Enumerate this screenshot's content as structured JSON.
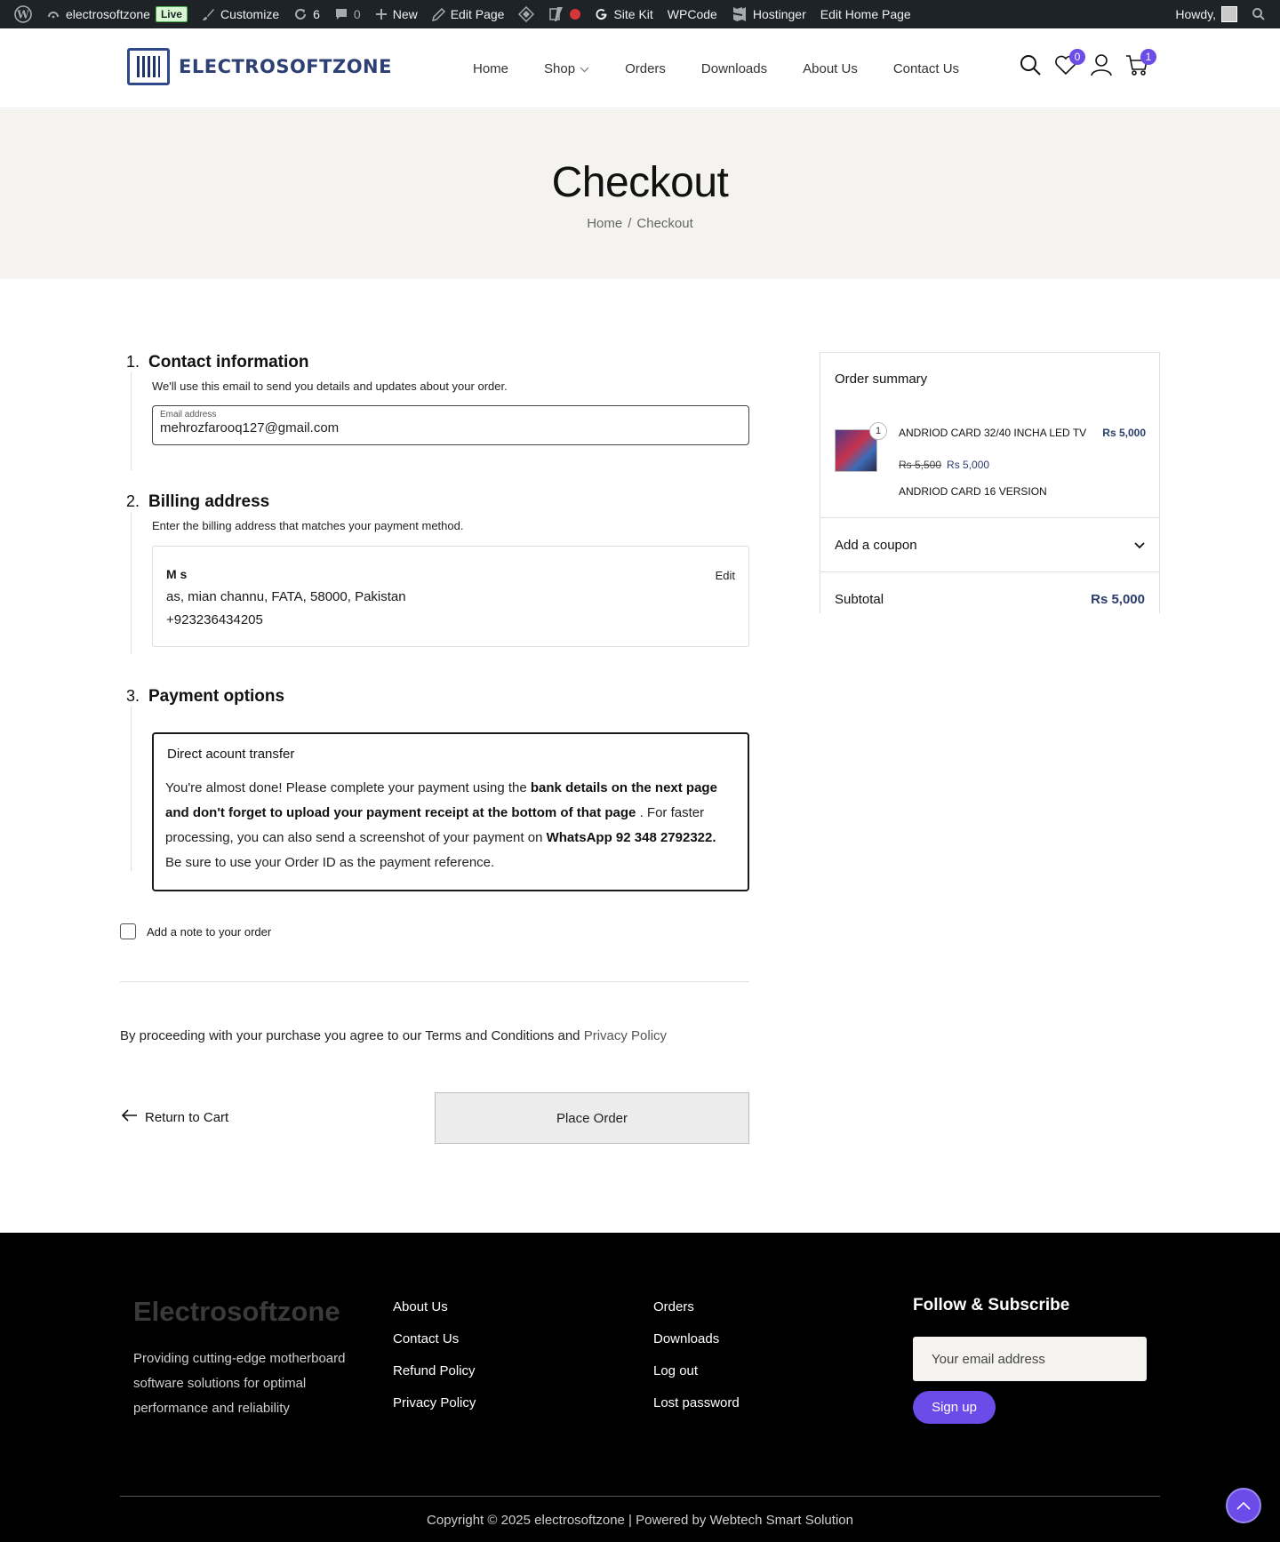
{
  "adminbar": {
    "site_name": "electrosoftzone",
    "live_badge": "Live",
    "customize": "Customize",
    "updates_count": "6",
    "comments_count": "0",
    "new": "New",
    "edit_page": "Edit Page",
    "site_kit": "Site Kit",
    "wpcode": "WPCode",
    "hostinger": "Hostinger",
    "edit_home_page": "Edit Home Page",
    "howdy": "Howdy,"
  },
  "header": {
    "logo_text": "ELECTROSOFTZONE",
    "nav": [
      "Home",
      "Shop",
      "Orders",
      "Downloads",
      "About Us",
      "Contact Us"
    ],
    "wishlist_count": "0",
    "cart_count": "1"
  },
  "banner": {
    "title": "Checkout",
    "breadcrumb_home": "Home",
    "breadcrumb_sep": "/",
    "breadcrumb_current": "Checkout"
  },
  "contact": {
    "number": "1.",
    "title": "Contact information",
    "description": "We'll use this email to send you details and updates about your order.",
    "email_label": "Email address",
    "email_value": "mehrozfarooq127@gmail.com"
  },
  "billing": {
    "number": "2.",
    "title": "Billing address",
    "description": "Enter the billing address that matches your payment method.",
    "name": "M s",
    "address": "as, mian channu, FATA, 58000, Pakistan",
    "phone": "+923236434205",
    "edit_label": "Edit"
  },
  "payment": {
    "number": "3.",
    "title": "Payment options",
    "method": "Direct acount transfer",
    "text_1": "You're almost done! Please complete your payment using the ",
    "bold_1": "bank details on the next page and don't forget to upload your payment receipt at the bottom of that page",
    "text_2": " . For faster processing, you can also send a screenshot of your payment on ",
    "bold_2": "WhatsApp 92 348 2792322.",
    "text_3": " Be sure to use your Order ID as the payment reference."
  },
  "order_note_label": "Add a note to your order",
  "terms": {
    "text": "By proceeding with your purchase you agree to our Terms and Conditions and ",
    "privacy": "Privacy Policy"
  },
  "actions": {
    "return_to_cart": "Return to Cart",
    "place_order": "Place Order"
  },
  "summary": {
    "title": "Order summary",
    "item_qty": "1",
    "item_name": "ANDRIOD CARD 32/40 INCHA LED TV",
    "item_total": "Rs 5,000",
    "item_regular_price": "Rs 5,500",
    "item_sale_price": "Rs 5,000",
    "item_description": "ANDRIOD CARD 16 VERSION",
    "coupon_label": "Add a coupon",
    "subtotal_label": "Subtotal",
    "subtotal_value": "Rs 5,000"
  },
  "footer": {
    "brand": "Electrosoftzone",
    "about": "Providing cutting-edge motherboard software solutions for optimal performance and reliability",
    "col1": [
      "About Us",
      "Contact Us",
      "Refund Policy",
      "Privacy Policy"
    ],
    "col2": [
      "Orders",
      "Downloads",
      "Log out",
      "Lost password"
    ],
    "subscribe_title": "Follow & Subscribe",
    "email_placeholder": "Your email address",
    "signup": "Sign up",
    "copyright": "Copyright © 2025 electrosoftzone | Powered by Webtech Smart Solution"
  },
  "colors": {
    "accent": "#6c4ce8",
    "admin_bar": "#1d2327",
    "banner_bg": "#f4f3f0",
    "price_blue": "#2a3c6b"
  }
}
